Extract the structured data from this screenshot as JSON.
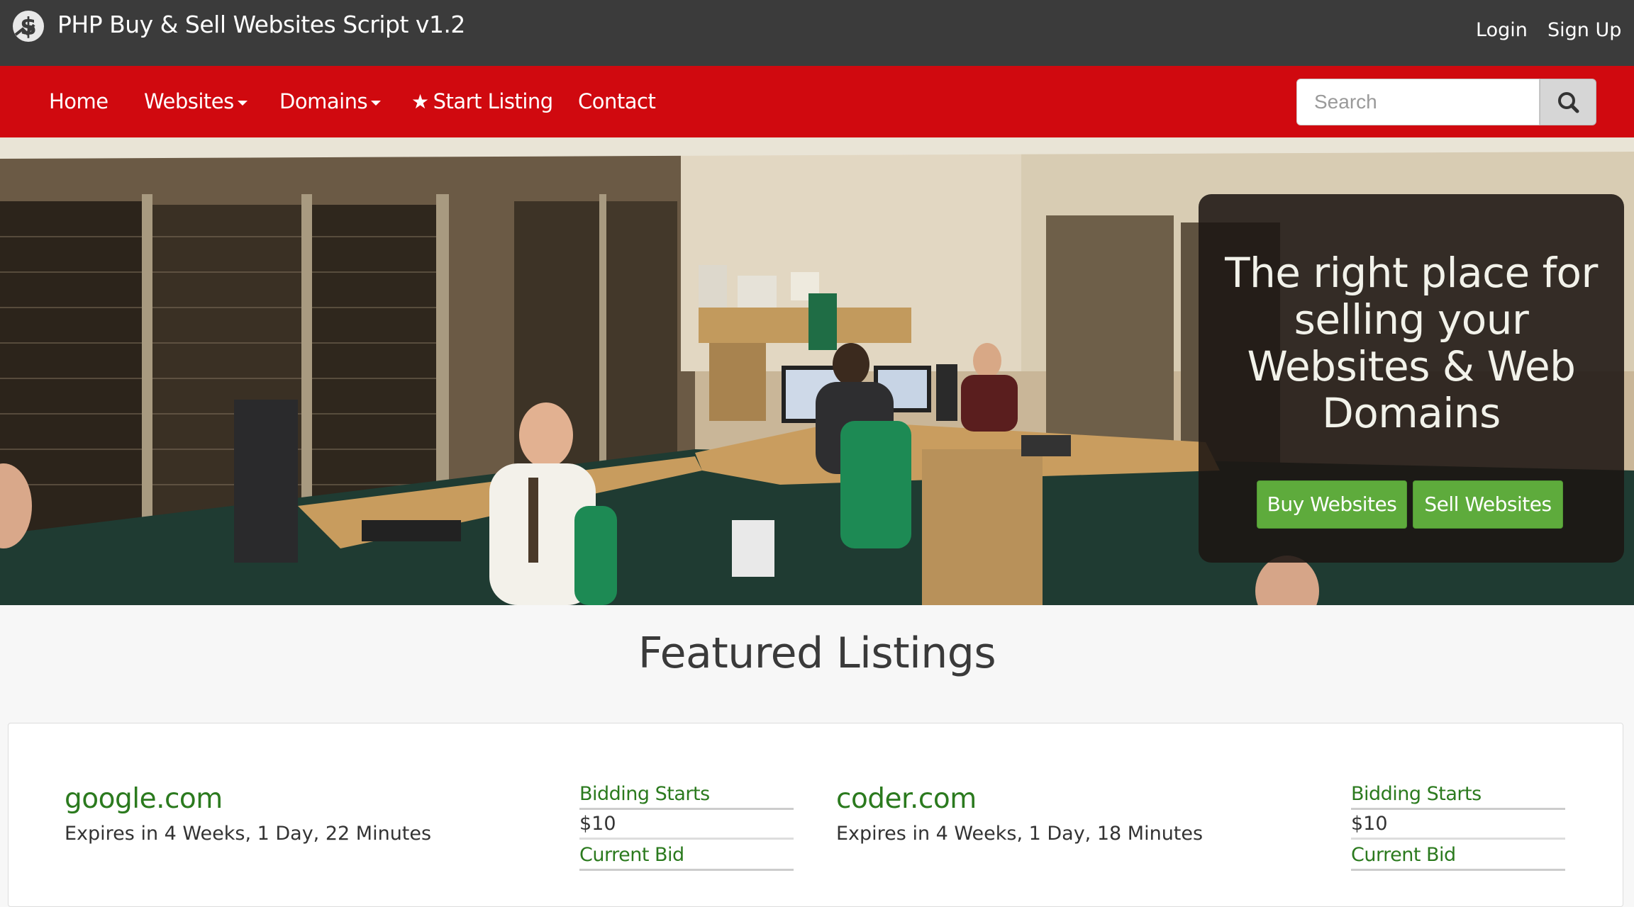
{
  "header": {
    "brand": "PHP Buy & Sell Websites Script v1.2",
    "login": "Login",
    "signup": "Sign Up"
  },
  "nav": {
    "home": "Home",
    "websites": "Websites",
    "domains": "Domains",
    "start_listing": "Start Listing",
    "contact": "Contact",
    "search_placeholder": "Search"
  },
  "hero": {
    "title": "The right place for selling your Websites & Web Domains",
    "buy_button": "Buy Websites",
    "sell_button": "Sell Websites"
  },
  "featured": {
    "title": "Featured Listings",
    "listings": [
      {
        "name": "google.com",
        "expires": "Expires in 4 Weeks, 1 Day, 22 Minutes",
        "bidding_starts_label": "Bidding Starts",
        "bidding_starts_value": "$10",
        "current_bid_label": "Current Bid"
      },
      {
        "name": "coder.com",
        "expires": "Expires in 4 Weeks, 1 Day, 18 Minutes",
        "bidding_starts_label": "Bidding Starts",
        "bidding_starts_value": "$10",
        "current_bid_label": "Current Bid"
      }
    ]
  },
  "colors": {
    "topbar": "#3b3b3b",
    "navbar": "#d0090f",
    "accent_green": "#5eab3c",
    "link_green": "#2b7a1e"
  },
  "icons": {
    "logo": "dollar-icon",
    "search": "search-icon",
    "star": "star-icon",
    "caret": "caret-down-icon"
  }
}
